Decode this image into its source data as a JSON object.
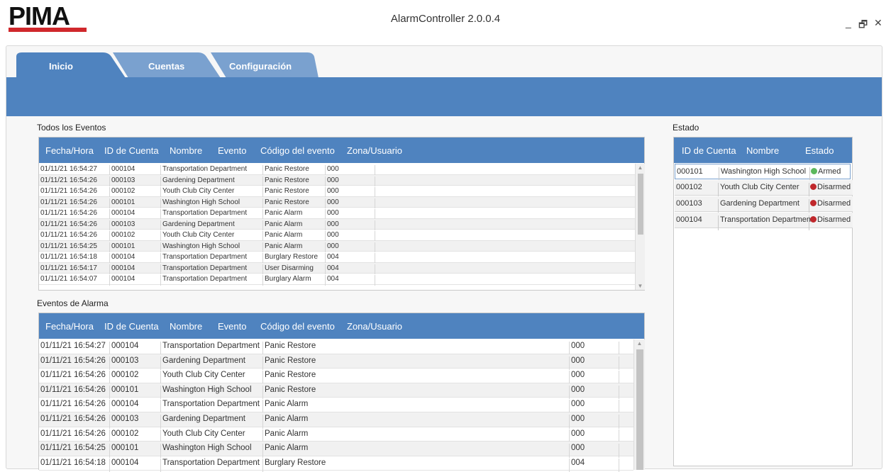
{
  "app": {
    "logo_text": "PIMA",
    "title": "AlarmController 2.0.0.4",
    "minimize": "_",
    "restore": "🗗",
    "close": "✕"
  },
  "tabs": [
    {
      "label": "Inicio"
    },
    {
      "label": "Cuentas"
    },
    {
      "label": "Configuración"
    }
  ],
  "all_events": {
    "title": "Todos los Eventos",
    "headers": [
      "Fecha/Hora",
      "ID de Cuenta",
      "Nombre",
      "Evento",
      "Código del evento",
      "Zona/Usuario"
    ],
    "rows": [
      [
        "01/11/21 16:54:27",
        "000104",
        "Transportation Department",
        "Panic Restore",
        "000"
      ],
      [
        "01/11/21 16:54:26",
        "000103",
        "Gardening Department",
        "Panic Restore",
        "000"
      ],
      [
        "01/11/21 16:54:26",
        "000102",
        "Youth Club City Center",
        "Panic Restore",
        "000"
      ],
      [
        "01/11/21 16:54:26",
        "000101",
        "Washington High School",
        "Panic Restore",
        "000"
      ],
      [
        "01/11/21 16:54:26",
        "000104",
        "Transportation Department",
        "Panic Alarm",
        "000"
      ],
      [
        "01/11/21 16:54:26",
        "000103",
        "Gardening Department",
        "Panic Alarm",
        "000"
      ],
      [
        "01/11/21 16:54:26",
        "000102",
        "Youth Club City Center",
        "Panic Alarm",
        "000"
      ],
      [
        "01/11/21 16:54:25",
        "000101",
        "Washington High School",
        "Panic Alarm",
        "000"
      ],
      [
        "01/11/21 16:54:18",
        "000104",
        "Transportation Department",
        "Burglary Restore",
        "004"
      ],
      [
        "01/11/21 16:54:17",
        "000104",
        "Transportation Department",
        "User Disarming",
        "004"
      ],
      [
        "01/11/21 16:54:07",
        "000104",
        "Transportation Department",
        "Burglary Alarm",
        "004"
      ]
    ]
  },
  "alarm_events": {
    "title": "Eventos de Alarma",
    "headers": [
      "Fecha/Hora",
      "ID de Cuenta",
      "Nombre",
      "Evento",
      "Código del evento",
      "Zona/Usuario"
    ],
    "rows": [
      [
        "01/11/21 16:54:27",
        "000104",
        "Transportation Department",
        "Panic Restore",
        "000"
      ],
      [
        "01/11/21 16:54:26",
        "000103",
        "Gardening Department",
        "Panic Restore",
        "000"
      ],
      [
        "01/11/21 16:54:26",
        "000102",
        "Youth Club City Center",
        "Panic Restore",
        "000"
      ],
      [
        "01/11/21 16:54:26",
        "000101",
        "Washington High School",
        "Panic Restore",
        "000"
      ],
      [
        "01/11/21 16:54:26",
        "000104",
        "Transportation Department",
        "Panic Alarm",
        "000"
      ],
      [
        "01/11/21 16:54:26",
        "000103",
        "Gardening Department",
        "Panic Alarm",
        "000"
      ],
      [
        "01/11/21 16:54:26",
        "000102",
        "Youth Club City Center",
        "Panic Alarm",
        "000"
      ],
      [
        "01/11/21 16:54:25",
        "000101",
        "Washington High School",
        "Panic Alarm",
        "000"
      ],
      [
        "01/11/21 16:54:18",
        "000104",
        "Transportation Department",
        "Burglary Restore",
        "004"
      ]
    ]
  },
  "status": {
    "title": "Estado",
    "headers": [
      "ID de Cuenta",
      "Nombre",
      "Estado"
    ],
    "rows": [
      {
        "id": "000101",
        "name": "Washington High School",
        "state": "Armed",
        "color": "#5cb85c"
      },
      {
        "id": "000102",
        "name": "Youth Club City Center",
        "state": "Disarmed",
        "color": "#c0282c"
      },
      {
        "id": "000103",
        "name": "Gardening Department",
        "state": "Disarmed",
        "color": "#c0282c"
      },
      {
        "id": "000104",
        "name": "Transportation Department",
        "state": "Disarmed",
        "color": "#c0282c"
      }
    ]
  },
  "colors": {
    "accent": "#4f83bf",
    "logo_red": "#d0282c"
  }
}
